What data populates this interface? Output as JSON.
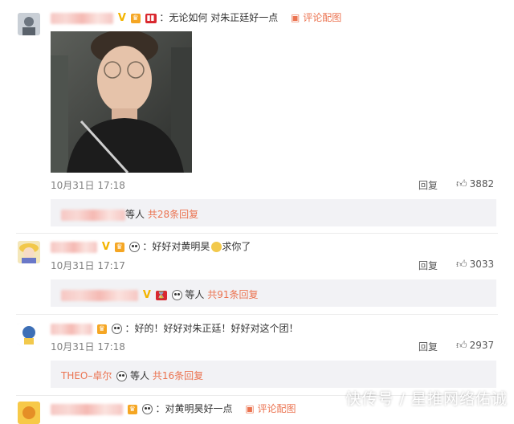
{
  "comments": [
    {
      "text": "：无论如何 对朱正廷好一点",
      "pic_link": "评论配图",
      "time": "10月31日 17:18",
      "reply": "回复",
      "likes": "3882",
      "sub_suffix": "等人",
      "sub_count": "共28条回复"
    },
    {
      "text": "：好好对黄明昊",
      "text_after": "求你了",
      "time": "10月31日 17:17",
      "reply": "回复",
      "likes": "3033",
      "sub_suffix": "等人",
      "sub_count": "共91条回复"
    },
    {
      "text": "：好的！好好对朱正廷！好好对这个团！",
      "time": "10月31日 17:18",
      "reply": "回复",
      "likes": "2937",
      "sub_user": "THEO–卓尔",
      "sub_suffix": "等人",
      "sub_count": "共16条回复"
    },
    {
      "text": "：对黄明昊好一点",
      "pic_link": "评论配图"
    }
  ],
  "watermark": "快传号 / 星推网络佑诚",
  "icons": {
    "thumb": "thumbs-up-icon",
    "pic": "image-icon"
  },
  "colors": {
    "accent": "#eb7350",
    "subbox_bg": "#f2f2f5"
  }
}
